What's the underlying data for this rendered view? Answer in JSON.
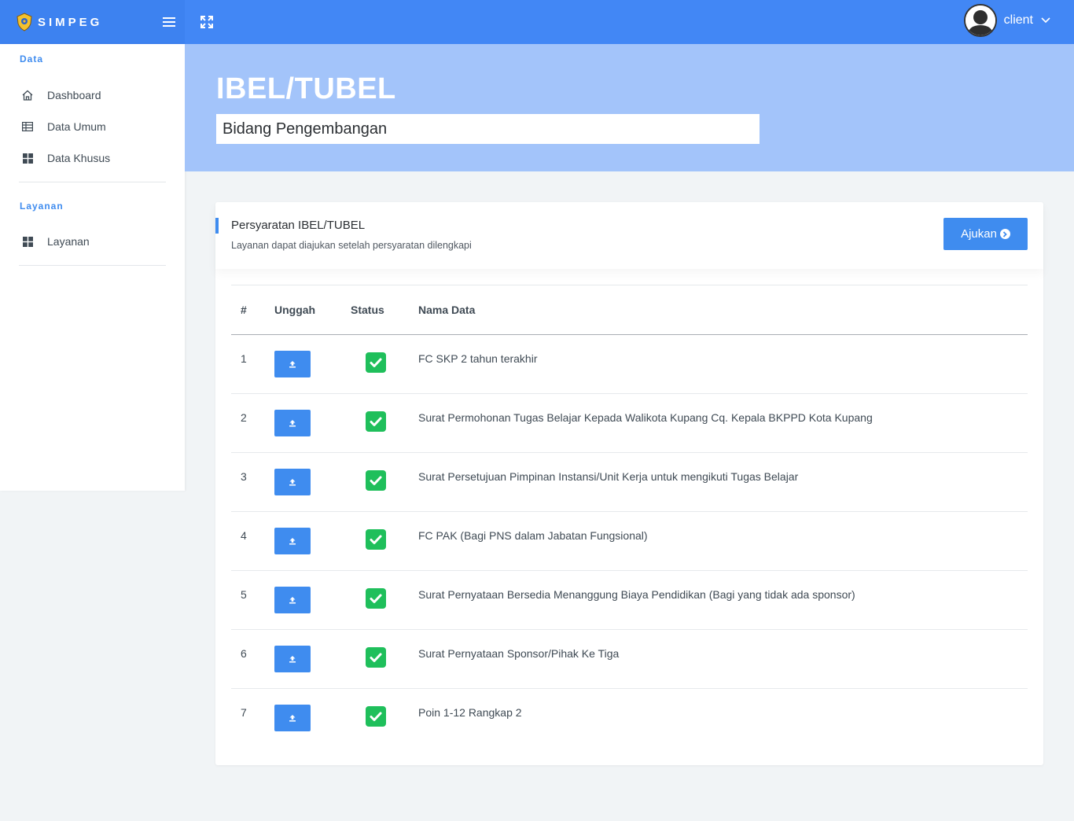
{
  "app": {
    "brand": "SIMPEG"
  },
  "topbar": {
    "user_name": "client"
  },
  "sidebar": {
    "sections": [
      {
        "heading": "Data",
        "items": [
          {
            "label": "Dashboard",
            "icon": "home-icon"
          },
          {
            "label": "Data Umum",
            "icon": "table-icon"
          },
          {
            "label": "Data Khusus",
            "icon": "grid-icon"
          }
        ]
      },
      {
        "heading": "Layanan",
        "items": [
          {
            "label": "Layanan",
            "icon": "grid-icon"
          }
        ]
      }
    ]
  },
  "header": {
    "title": "IBEL/TUBEL",
    "subtitle": "Bidang Pengembangan"
  },
  "card": {
    "title": "Persyaratan IBEL/TUBEL",
    "description": "Layanan dapat diajukan setelah persyaratan dilengkapi",
    "submit_label": "Ajukan"
  },
  "table": {
    "columns": [
      "#",
      "Unggah",
      "Status",
      "Nama Data"
    ],
    "rows": [
      {
        "no": "1",
        "status": "complete",
        "name": "FC SKP 2 tahun terakhir"
      },
      {
        "no": "2",
        "status": "complete",
        "name": "Surat Permohonan Tugas Belajar Kepada Walikota Kupang Cq. Kepala BKPPD Kota Kupang"
      },
      {
        "no": "3",
        "status": "complete",
        "name": "Surat Persetujuan Pimpinan Instansi/Unit Kerja untuk mengikuti Tugas Belajar"
      },
      {
        "no": "4",
        "status": "complete",
        "name": "FC PAK (Bagi PNS dalam Jabatan Fungsional)"
      },
      {
        "no": "5",
        "status": "complete",
        "name": "Surat Pernyataan Bersedia Menanggung Biaya Pendidikan (Bagi yang tidak ada sponsor)"
      },
      {
        "no": "6",
        "status": "complete",
        "name": "Surat Pernyataan Sponsor/Pihak Ke Tiga"
      },
      {
        "no": "7",
        "status": "complete",
        "name": "Poin 1-12 Rangkap 2"
      }
    ]
  },
  "colors": {
    "primary": "#3f8cef",
    "topbar": "#4287f5",
    "hero": "#a3c4fa",
    "success": "#1fbf5b"
  }
}
